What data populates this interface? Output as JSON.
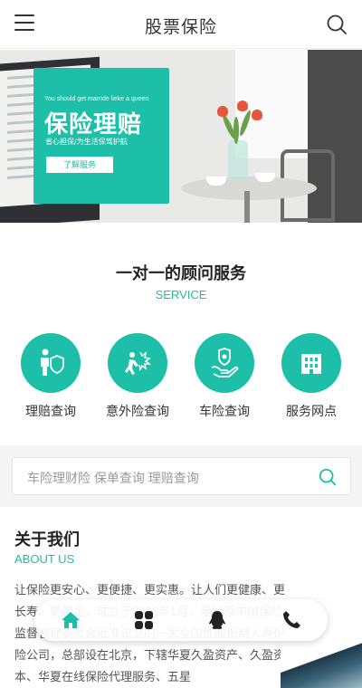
{
  "header": {
    "title": "股票保险",
    "menu_icon": "menu-icon",
    "search_icon": "search-icon"
  },
  "banner": {
    "card_en": "You should get marride lieke a queen",
    "card_title": "保险理赔",
    "card_sub": "省心担保/为生活保驾护航",
    "card_button": "了解服务"
  },
  "service": {
    "title": "一对一的顾问服务",
    "subtitle": "SERVICE",
    "items": [
      {
        "label": "理赔查询",
        "icon": "person-shield-icon"
      },
      {
        "label": "意外险查询",
        "icon": "accident-icon"
      },
      {
        "label": "车险查询",
        "icon": "hand-shield-icon"
      },
      {
        "label": "服务网点",
        "icon": "building-icon"
      }
    ]
  },
  "search": {
    "placeholder": "车险理财险 保单查询 理赔查询"
  },
  "about": {
    "title": "关于我们",
    "subtitle": "ABOUT US",
    "text": "让保险更安心、更便捷、更实惠。让人们更健康、更长寿、更富足，成立于2008年1月，是经原中国保险监督管理委员会批准设立的一家全国性股份制人寿保险公司，总部设在北京，下辖华夏久盈资产、久盈资本、华夏在线保险代理服务、五星"
  },
  "float_nav": {
    "items": [
      "home-icon",
      "grid-icon",
      "qq-penguin-icon",
      "phone-icon"
    ]
  },
  "colors": {
    "accent": "#1ebfa8"
  }
}
